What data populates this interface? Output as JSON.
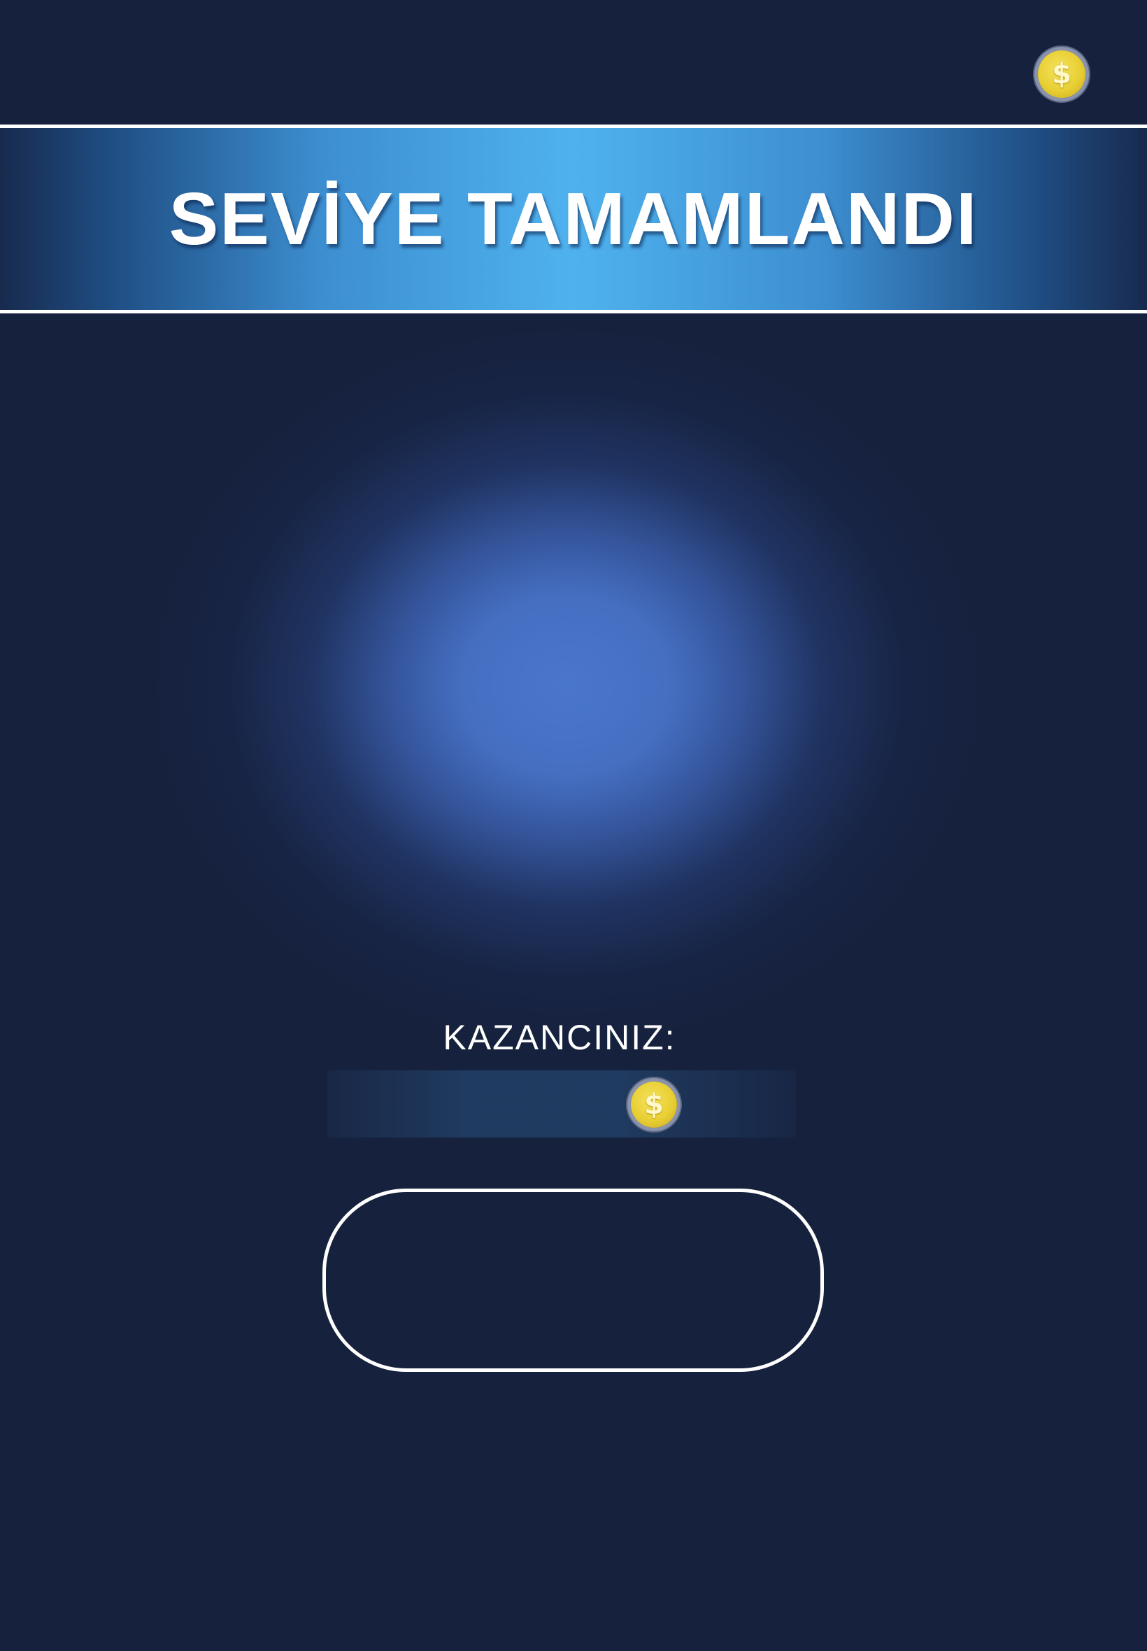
{
  "header": {
    "coin_icon": "coin-icon",
    "coin_symbol": "$"
  },
  "banner": {
    "title": "SEVİYE TAMAMLANDI"
  },
  "earnings": {
    "label": "KAZANCINIZ:",
    "coin_icon": "coin-icon",
    "coin_symbol": "$"
  },
  "continue_button": {
    "label": ""
  },
  "colors": {
    "background": "#16213d",
    "banner_center": "#4fb2ef",
    "glow": "#4a76ca",
    "coin": "#e8cf34",
    "text": "#ffffff"
  }
}
